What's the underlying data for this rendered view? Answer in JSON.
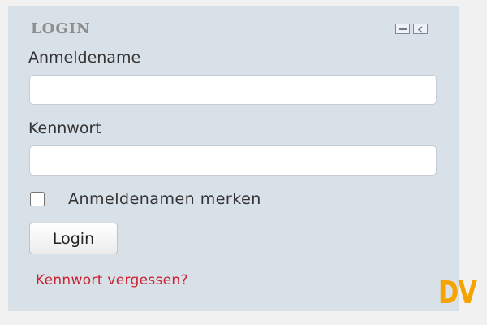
{
  "block": {
    "title": "LOGIN",
    "controls": {
      "minimize_icon": "minimize-icon",
      "dock_icon": "dock-icon"
    }
  },
  "form": {
    "username_label": "Anmeldename",
    "username_value": "",
    "password_label": "Kennwort",
    "password_value": "",
    "remember_label": "Anmeldenamen merken",
    "remember_checked": false,
    "login_button": "Login",
    "forgot_link": "Kennwort vergessen?"
  },
  "watermark": {
    "text": "DV",
    "color": "#f5a300"
  },
  "colors": {
    "block_background": "#d8e0e8",
    "link": "#cc2233"
  }
}
